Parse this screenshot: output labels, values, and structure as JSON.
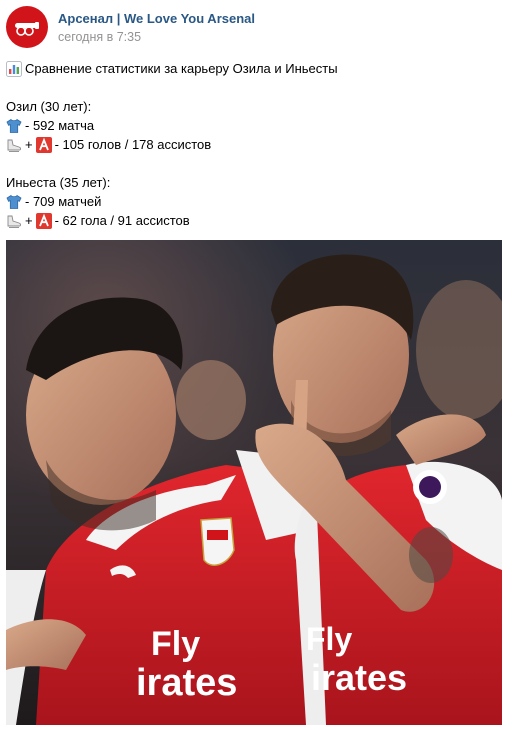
{
  "post": {
    "author": "Арсенал | We Love You Arsenal",
    "timestamp": "сегодня в 7:35",
    "title": "Сравнение статистики за карьеру Озила и Иньесты",
    "player1": {
      "name": "Озил (30 лет):",
      "matches": "- 592 матча",
      "plus": "+",
      "goals_assists": "- 105 голов / 178 ассистов"
    },
    "player2": {
      "name": "Иньеста (35 лет):",
      "matches": "- 709 матчей",
      "plus": "+",
      "goals_assists": "- 62 гола / 91 ассистов"
    },
    "image_alt": "Fly Emirates"
  },
  "icons": {
    "title": "bar-chart-icon",
    "matches": "shirt-icon",
    "goals": "boot-icon",
    "assists": "a-letter-icon"
  },
  "colors": {
    "link": "#2a5885",
    "muted": "#939393",
    "arsenal_red": "#d0141a"
  }
}
